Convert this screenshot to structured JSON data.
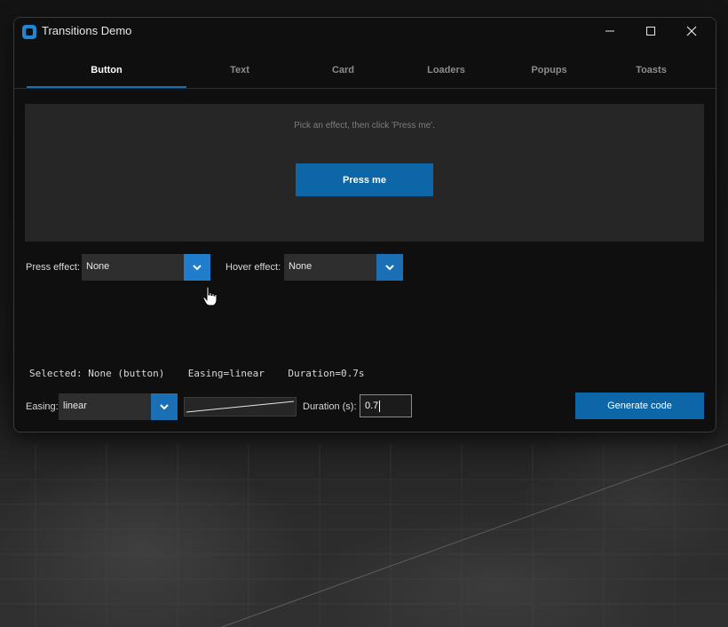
{
  "window": {
    "title": "Transitions Demo",
    "accent_color": "#1473b7"
  },
  "titlebar": {
    "icons": [
      "app-icon",
      "minimize-icon",
      "maximize-icon",
      "close-icon"
    ]
  },
  "tabs": [
    {
      "label": "Button",
      "active": true
    },
    {
      "label": "Text",
      "active": false
    },
    {
      "label": "Card",
      "active": false
    },
    {
      "label": "Loaders",
      "active": false
    },
    {
      "label": "Popups",
      "active": false
    },
    {
      "label": "Toasts",
      "active": false
    }
  ],
  "preview": {
    "hint": "Pick an effect, then click 'Press me'.",
    "button_label": "Press me"
  },
  "effects": {
    "press_label": "Press effect:",
    "press_value": "None",
    "hover_label": "Hover effect:",
    "hover_value": "None"
  },
  "status": {
    "text": "Selected: None (button)    Easing=linear    Duration=0.7s"
  },
  "controls": {
    "easing_label": "Easing:",
    "easing_value": "linear",
    "duration_label": "Duration (s):",
    "duration_value": "0.7",
    "generate_label": "Generate code"
  }
}
